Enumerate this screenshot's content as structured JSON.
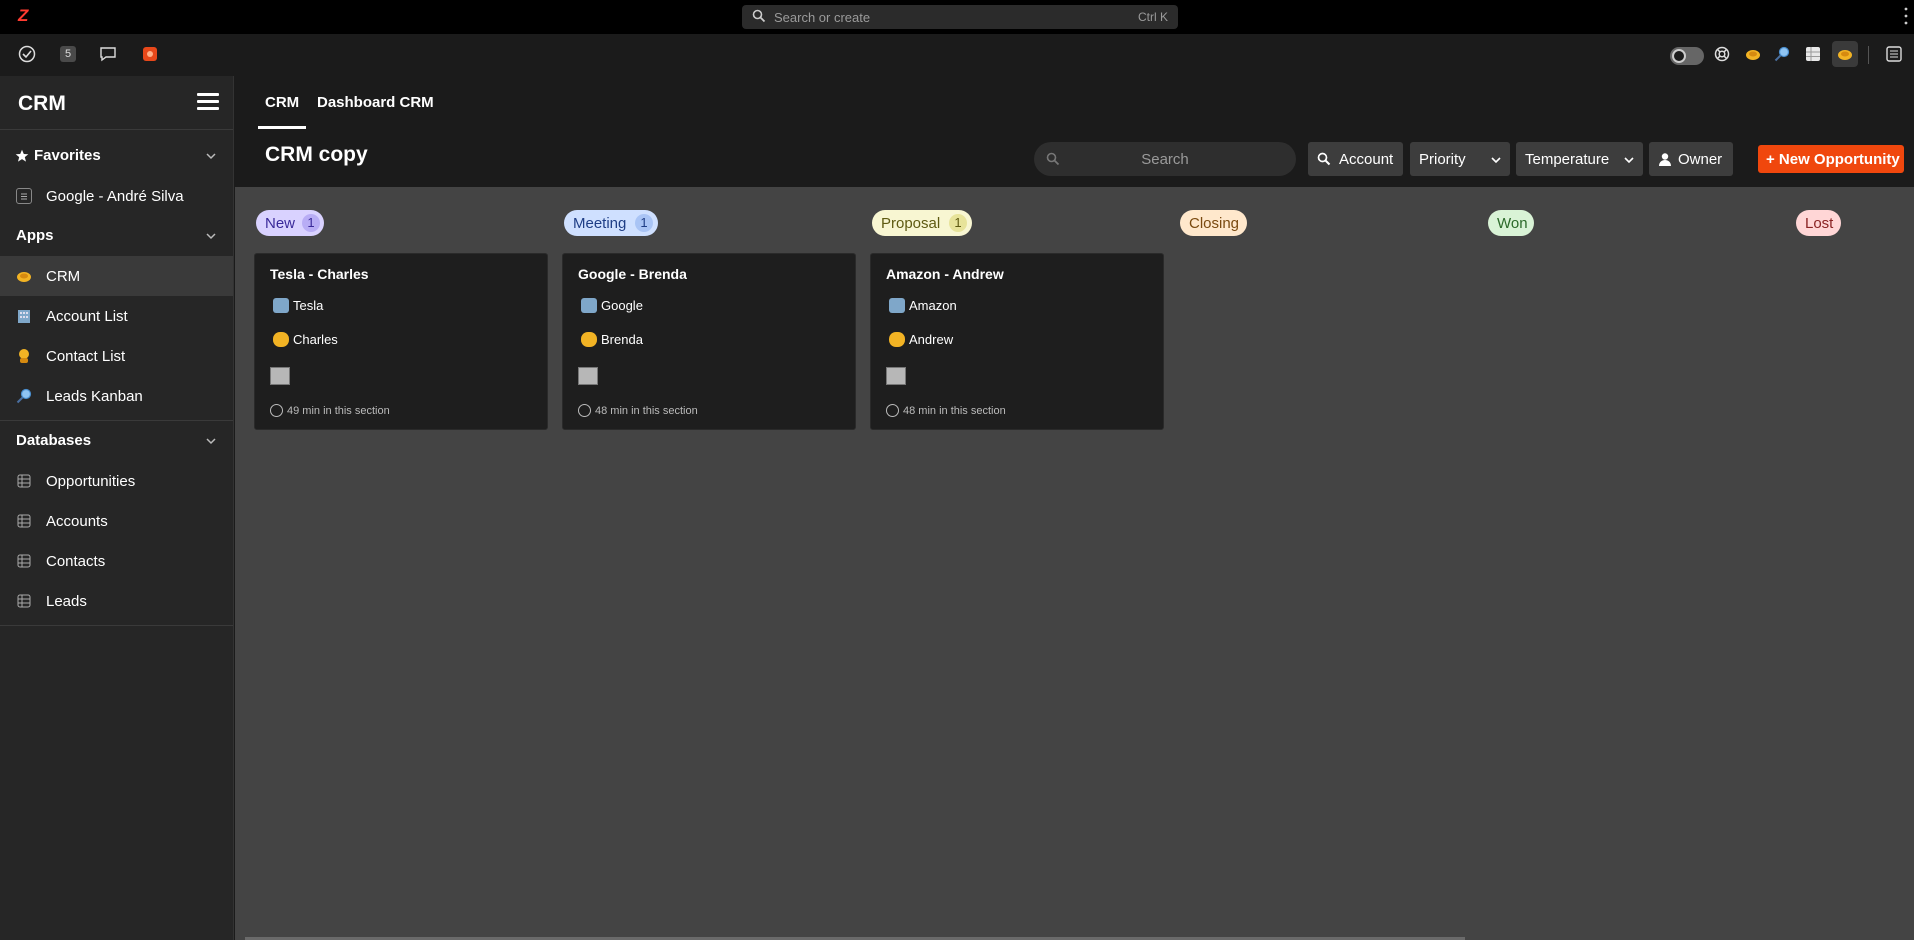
{
  "topbar": {
    "logo": "Z",
    "search_placeholder": "Search or create",
    "search_shortcut": "Ctrl K"
  },
  "toolbar": {
    "badge_count": "5",
    "left_icons": [
      "check-circle-icon",
      "count-badge",
      "chat-icon",
      "app-orange-icon"
    ],
    "right_icons": [
      "toggle-switch",
      "lifebuoy-icon",
      "handshake-icon",
      "magnifier-icon",
      "table-icon",
      "handshake-active-icon",
      "panel-icon"
    ]
  },
  "sidebar": {
    "title": "CRM",
    "favorites": {
      "label": "Favorites",
      "items": [
        {
          "label": "Google - André Silva",
          "icon": "doc-icon"
        }
      ]
    },
    "apps": {
      "label": "Apps",
      "items": [
        {
          "label": "CRM",
          "icon": "handshake-icon",
          "active": true
        },
        {
          "label": "Account List",
          "icon": "building-icon"
        },
        {
          "label": "Contact List",
          "icon": "person-icon"
        },
        {
          "label": "Leads Kanban",
          "icon": "magnifier-icon"
        }
      ]
    },
    "databases": {
      "label": "Databases",
      "items": [
        {
          "label": "Opportunities",
          "icon": "table-icon"
        },
        {
          "label": "Accounts",
          "icon": "table-icon"
        },
        {
          "label": "Contacts",
          "icon": "table-icon"
        },
        {
          "label": "Leads",
          "icon": "table-icon"
        }
      ]
    }
  },
  "tabs": [
    {
      "label": "CRM",
      "active": true
    },
    {
      "label": "Dashboard CRM",
      "active": false
    }
  ],
  "page": {
    "title": "CRM copy",
    "search_placeholder": "Search",
    "filters": {
      "account": "Account",
      "priority": "Priority",
      "temperature": "Temperature",
      "owner": "Owner"
    },
    "new_button": "+ New Opportunity"
  },
  "columns": [
    {
      "name": "New",
      "count": "1",
      "bg": "#d9d2ff",
      "fg": "#3a2a9a",
      "cnt_bg": "#b8adf5"
    },
    {
      "name": "Meeting",
      "count": "1",
      "bg": "#cfe0ff",
      "fg": "#1f3e86",
      "cnt_bg": "#a9c4f5"
    },
    {
      "name": "Proposal",
      "count": "1",
      "bg": "#f8f6d2",
      "fg": "#5e5a12",
      "cnt_bg": "#e7e39a"
    },
    {
      "name": "Closing",
      "count": "",
      "bg": "#ffe8cc",
      "fg": "#7a4a10",
      "cnt_bg": ""
    },
    {
      "name": "Won",
      "count": "",
      "bg": "#d9f3d6",
      "fg": "#2c6a2a",
      "cnt_bg": ""
    },
    {
      "name": "Lost",
      "count": "",
      "bg": "#ffd6d6",
      "fg": "#8a2323",
      "cnt_bg": ""
    }
  ],
  "cards": [
    {
      "title": "Tesla - Charles",
      "account": "Tesla",
      "contact": "Charles",
      "time": "49 min in this section"
    },
    {
      "title": "Google - Brenda",
      "account": "Google",
      "contact": "Brenda",
      "time": "48 min in this section"
    },
    {
      "title": "Amazon - Andrew",
      "account": "Amazon",
      "contact": "Andrew",
      "time": "48 min in this section"
    }
  ]
}
